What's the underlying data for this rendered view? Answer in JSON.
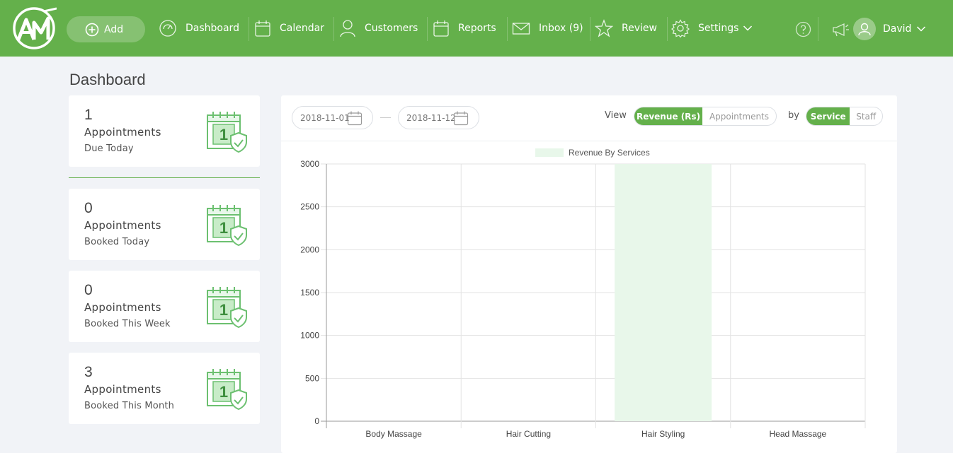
{
  "nav": {
    "add_label": "Add",
    "items": [
      {
        "label": "Dashboard",
        "icon": "dashboard-gauge-icon"
      },
      {
        "label": "Calendar",
        "icon": "calendar-icon"
      },
      {
        "label": "Customers",
        "icon": "user-icon"
      },
      {
        "label": "Reports",
        "icon": "reports-calendar-icon"
      },
      {
        "label": "Inbox (9)",
        "icon": "envelope-icon"
      },
      {
        "label": "Review",
        "icon": "star-icon"
      },
      {
        "label": "Settings",
        "icon": "gear-icon"
      }
    ],
    "user_name": "David"
  },
  "page": {
    "title": "Dashboard"
  },
  "stats": [
    {
      "value": "1",
      "label": "Appointments",
      "sub": "Due Today"
    },
    {
      "value": "0",
      "label": "Appointments",
      "sub": "Booked Today"
    },
    {
      "value": "0",
      "label": "Appointments",
      "sub": "Booked This Week"
    },
    {
      "value": "3",
      "label": "Appointments",
      "sub": "Booked This Month"
    }
  ],
  "calendar_icon_day": "1",
  "filters": {
    "date_from": "2018-11-01",
    "date_to": "2018-11-12",
    "view_label": "View",
    "view_options": [
      "Revenue (Rs)",
      "Appointments"
    ],
    "view_selected": "Revenue (Rs)",
    "by_label": "by",
    "by_options": [
      "Service",
      "Staff"
    ],
    "by_selected": "Service"
  },
  "colors": {
    "brand": "#64b04b",
    "bar_fill": "#e8f7ea",
    "icon_green": "#6cc070"
  },
  "chart_data": {
    "type": "bar",
    "legend": "Revenue By Services",
    "legend_position": "top",
    "categories": [
      "Body Massage",
      "Hair Cutting",
      "Hair Styling",
      "Head Massage"
    ],
    "series": [
      {
        "name": "Revenue By Services",
        "values": [
          0,
          0,
          3000,
          0
        ]
      }
    ],
    "ylim": [
      0,
      3000
    ],
    "yticks": [
      0,
      500,
      1000,
      1500,
      2000,
      2500,
      3000
    ],
    "grid": true
  }
}
